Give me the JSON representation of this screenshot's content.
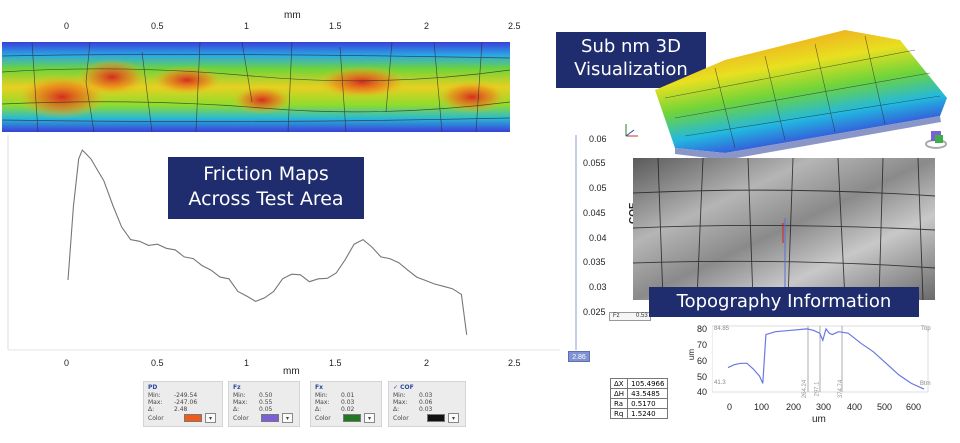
{
  "top_axis": {
    "unit": "mm",
    "ticks": [
      "0",
      "0.5",
      "1",
      "1.5",
      "2",
      "2.5"
    ]
  },
  "bottom_axis": {
    "unit": "mm",
    "ticks": [
      "0",
      "0.5",
      "1",
      "1.5",
      "2",
      "2.5"
    ]
  },
  "cof_axis": {
    "label": "COF",
    "ticks": [
      "0.06",
      "0.055",
      "0.05",
      "0.045",
      "0.04",
      "0.035",
      "0.03",
      "0.025"
    ],
    "cursor_value": "2.86"
  },
  "callouts": {
    "friction_line1": "Friction Maps",
    "friction_line2": "Across Test Area",
    "sub_nm_line1": "Sub nm 3D",
    "sub_nm_line2": "Visualization",
    "topography": "Topography Information"
  },
  "panels": [
    {
      "title": "PD",
      "min": "-249.54",
      "max": "-247.06",
      "delta": "2.48",
      "color": "#f05a1a"
    },
    {
      "title": "Fz",
      "min": "0.50",
      "max": "0.55",
      "delta": "0.05",
      "color": "#7b5fd6"
    },
    {
      "title": "Fx",
      "min": "0.01",
      "max": "0.03",
      "delta": "0.02",
      "color": "#1f7a1f"
    },
    {
      "title": "COF",
      "min": "0.03",
      "max": "0.06",
      "delta": "0.03",
      "color": "#111111"
    }
  ],
  "panel_keys": {
    "min": "Min:",
    "max": "Max:",
    "delta": "Δ:",
    "color": "Color"
  },
  "measurements": [
    {
      "k": "ΔX",
      "v": "105.4966"
    },
    {
      "k": "ΔH",
      "v": "43.5485"
    },
    {
      "k": "Ra",
      "v": "0.5170"
    },
    {
      "k": "Rq",
      "v": "1.5240"
    }
  ],
  "profile_axis": {
    "ylabel": "um",
    "xlabel": "um",
    "yticks": [
      "80",
      "70",
      "60",
      "50",
      "40"
    ],
    "xticks": [
      "0",
      "100",
      "200",
      "300",
      "400",
      "500",
      "600"
    ],
    "top_value": "84.85",
    "low_value": "41.3",
    "top_tag": "Top",
    "bottom_tag": "Btm",
    "marker_a": "264.24",
    "marker_b": "297.1",
    "marker_c": "374.74"
  },
  "fz_tag": "Fz",
  "fz_value": "0.53",
  "chart_data": {
    "type": "line",
    "xlabel": "mm",
    "ylabel": "COF",
    "xlim": [
      0,
      2.5
    ],
    "ylim": [
      0.025,
      0.06
    ],
    "series": [
      {
        "x": [
          0,
          0.03,
          0.06,
          0.08,
          0.1,
          0.13,
          0.16,
          0.2,
          0.25,
          0.3,
          0.35,
          0.4,
          0.45,
          0.5,
          0.55,
          0.6,
          0.65,
          0.7,
          0.75,
          0.8,
          0.85,
          0.9,
          0.95,
          1.0,
          1.05,
          1.1,
          1.15,
          1.2,
          1.25,
          1.3,
          1.35,
          1.4,
          1.45,
          1.5,
          1.55,
          1.6,
          1.65,
          1.7,
          1.75,
          1.8,
          1.85,
          1.9,
          1.95,
          2.0,
          2.05,
          2.1,
          2.15,
          2.2,
          2.23
        ],
        "values": [
          0.0355,
          0.048,
          0.0565,
          0.0578,
          0.0574,
          0.0562,
          0.0548,
          0.0525,
          0.0485,
          0.0445,
          0.0425,
          0.042,
          0.0415,
          0.0415,
          0.041,
          0.0405,
          0.0395,
          0.039,
          0.038,
          0.037,
          0.036,
          0.0355,
          0.0335,
          0.0325,
          0.0318,
          0.0322,
          0.0335,
          0.0355,
          0.0365,
          0.0362,
          0.0352,
          0.0355,
          0.0358,
          0.0365,
          0.039,
          0.0415,
          0.0425,
          0.041,
          0.0395,
          0.039,
          0.0385,
          0.037,
          0.036,
          0.0352,
          0.0348,
          0.0342,
          0.034,
          0.0328,
          0.026
        ]
      }
    ]
  },
  "profile_data": {
    "x": [
      0,
      20,
      40,
      60,
      80,
      100,
      110,
      120,
      150,
      200,
      250,
      270,
      290,
      300,
      310,
      320,
      330,
      350,
      380,
      420,
      460,
      500,
      540,
      580,
      620
    ],
    "values": [
      55,
      57,
      58,
      58,
      54,
      49,
      44,
      78,
      80,
      81,
      82,
      81,
      79,
      74,
      82,
      79,
      78,
      80,
      79,
      72,
      66,
      58,
      50,
      44,
      40
    ]
  }
}
